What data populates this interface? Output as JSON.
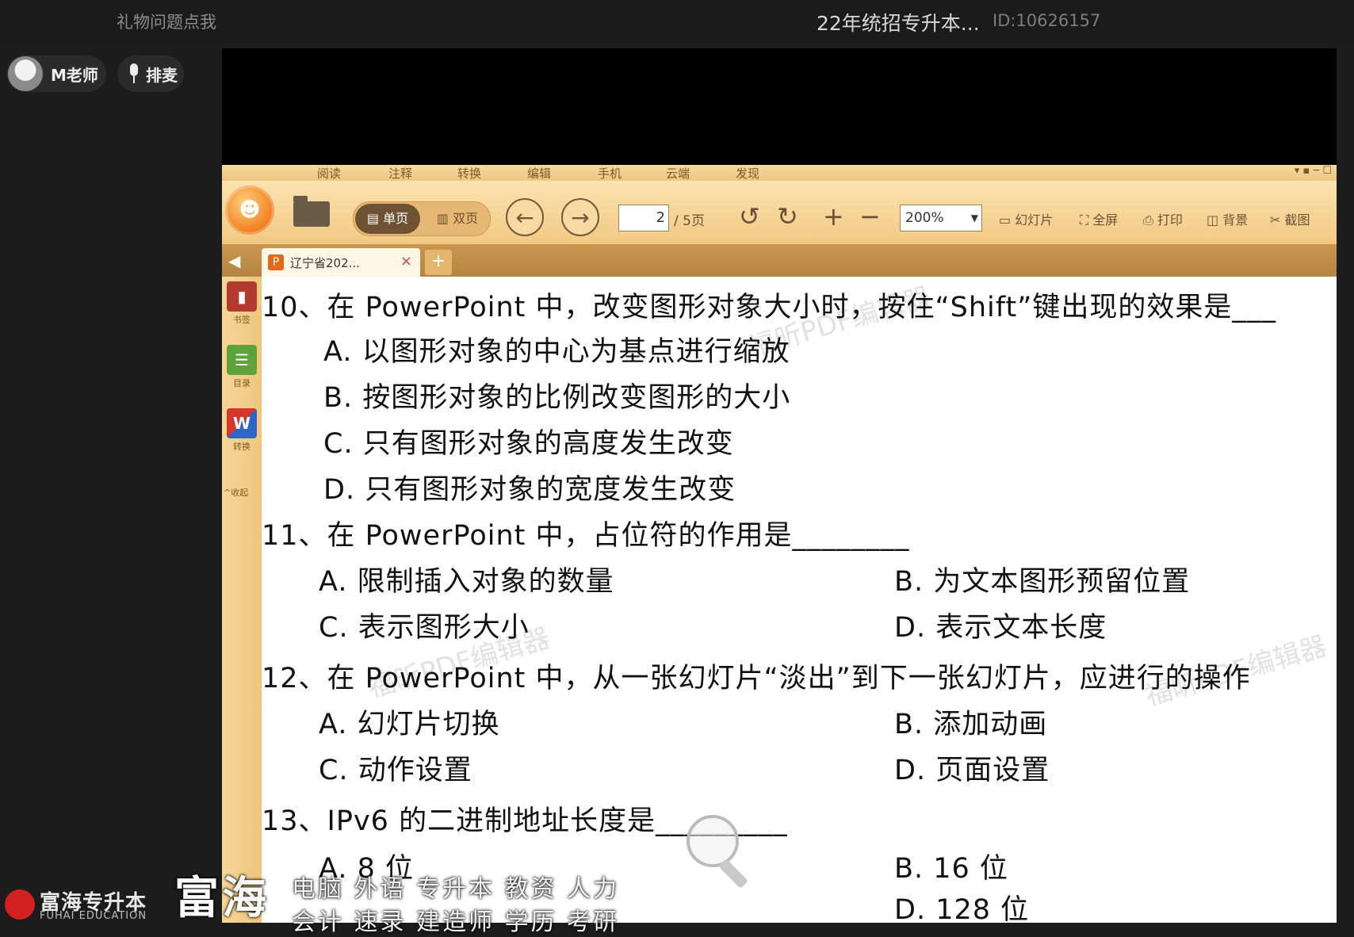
{
  "topbar": {
    "gift_link": "礼物问题点我",
    "room_title": "22年统招专升本...",
    "room_id": "ID:10626157"
  },
  "host": {
    "name": "M老师",
    "queue_label": "排麦"
  },
  "reader": {
    "menu": [
      "阅读",
      "注释",
      "转换",
      "编辑",
      "手机",
      "云端",
      "发现"
    ],
    "view_single": "单页",
    "view_double": "双页",
    "page_current": "2",
    "page_total": "/ 5页",
    "zoom": "200%",
    "tools": [
      "幻灯片",
      "全屏",
      "打印",
      "背景",
      "截图"
    ],
    "tab_label": "辽宁省202...",
    "sidebar": [
      "书签",
      "目录",
      "转换",
      "收起"
    ],
    "watermark": "福昕PDF编辑器"
  },
  "questions": [
    {
      "text": "10、在 PowerPoint 中，改变图形对象大小时，按住“Shift”键出现的效果是___",
      "options": [
        "A. 以图形对象的中心为基点进行缩放",
        "B. 按图形对象的比例改变图形的大小",
        "C. 只有图形对象的高度发生改变",
        "D. 只有图形对象的宽度发生改变"
      ]
    },
    {
      "text": "11、在 PowerPoint 中，占位符的作用是________",
      "options": [
        "A. 限制插入对象的数量",
        "B. 为文本图形预留位置",
        "C. 表示图形大小",
        "D. 表示文本长度"
      ]
    },
    {
      "text": "12、在 PowerPoint 中，从一张幻灯片“淡出”到下一张幻灯片，应进行的操作",
      "options": [
        "A. 幻灯片切换",
        "B. 添加动画",
        "C. 动作设置",
        "D. 页面设置"
      ]
    },
    {
      "text": "13、IPv6 的二进制地址长度是_________",
      "options": [
        "A. 8 位",
        "B. 16 位",
        "D. 128 位"
      ]
    }
  ],
  "brand": {
    "name_cn": "富海专升本",
    "name_en": "FUHAI EDUCATION",
    "big": "富海",
    "tags_line1": "电脑 外语 专升本 教资 人力",
    "tags_line2": "会计 速录 建造师 学历 考研"
  },
  "colors": {
    "toolbar": "#f2c983",
    "tabbar": "#b68443",
    "logo": "#f07d1c",
    "brand_red": "#d32020"
  }
}
